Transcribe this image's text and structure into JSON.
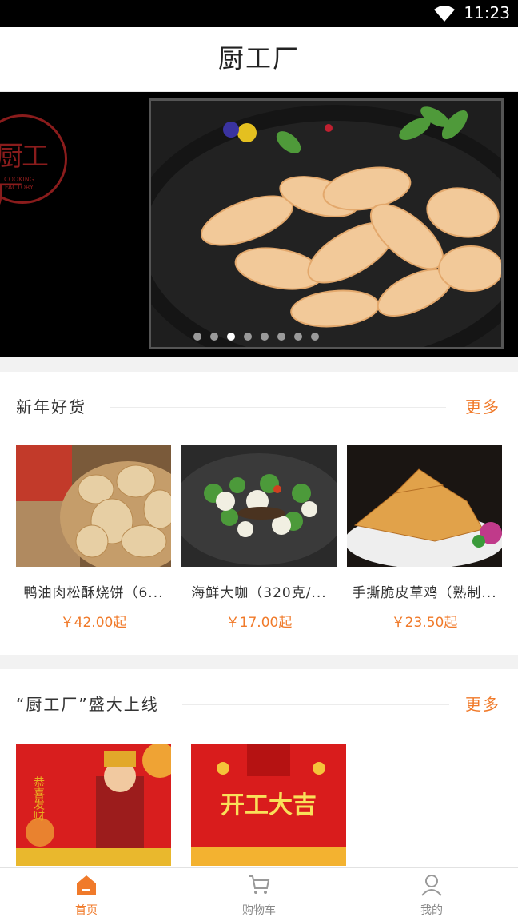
{
  "status": {
    "time": "11:23"
  },
  "header": {
    "title": "厨工厂"
  },
  "banner": {
    "logo_text": "厨工厂",
    "logo_sub_1": "COOKING",
    "logo_sub_2": "FACTORY",
    "dots": 8,
    "active_dot": 3
  },
  "section1": {
    "title": "新年好货",
    "more": "更多",
    "products": [
      {
        "name": "鸭油肉松酥烧饼（6...",
        "price": "￥42.00起"
      },
      {
        "name": "海鲜大咖（320克/...",
        "price": "￥17.00起"
      },
      {
        "name": "手撕脆皮草鸡（熟制...",
        "price": "￥23.50起"
      }
    ]
  },
  "section2": {
    "title": "“厨工厂”盛大上线",
    "more": "更多",
    "banners": [
      {
        "text": "恭喜发财"
      },
      {
        "text": "开工大吉"
      }
    ]
  },
  "tabbar": {
    "items": [
      {
        "label": "首页",
        "icon": "home-icon",
        "active": true
      },
      {
        "label": "购物车",
        "icon": "cart-icon",
        "active": false
      },
      {
        "label": "我的",
        "icon": "user-icon",
        "active": false
      }
    ]
  },
  "colors": {
    "accent": "#f07a2a"
  }
}
